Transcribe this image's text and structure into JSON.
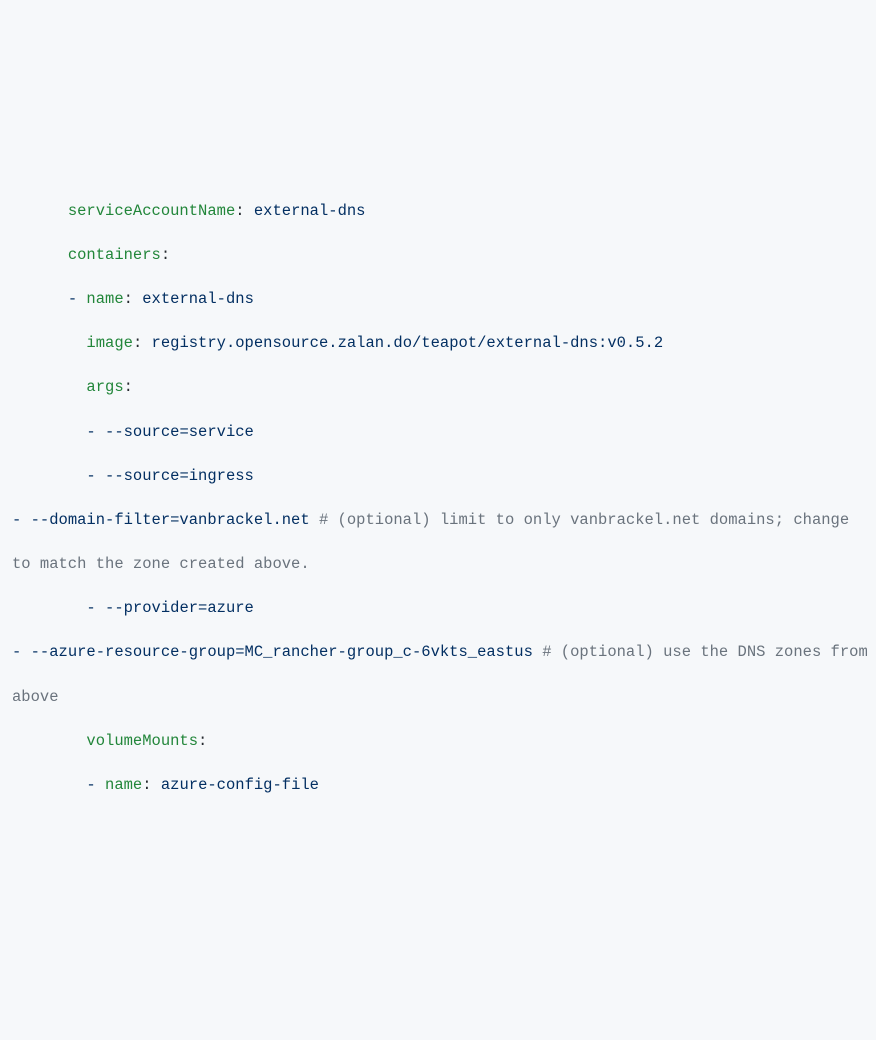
{
  "lines": {
    "l1": {
      "indent": "      ",
      "key": "serviceAccountName",
      "colon": ": ",
      "val": "external-dns"
    },
    "l2": {
      "indent": "      ",
      "key": "containers",
      "colon": ":"
    },
    "l3": {
      "indent": "      ",
      "dash": "- ",
      "key": "name",
      "colon": ": ",
      "val": "external-dns"
    },
    "l4": {
      "indent": "        ",
      "key": "image",
      "colon": ": ",
      "val": "registry.opensource.zalan.do/teapot/external-dns:v0.5.2"
    },
    "l5": {
      "indent": "        ",
      "key": "args",
      "colon": ":"
    },
    "l6": {
      "indent": "        ",
      "dash": "- ",
      "val": "--source=service"
    },
    "l7": {
      "indent": "        ",
      "dash": "- ",
      "val": "--source=ingress"
    },
    "l8": {
      "indent": "        ",
      "dash": "- ",
      "val": "--domain-filter=vanbrackel.net",
      "comment": " # (optional) limit to only vanbrackel.net domains; change to match the zone created above."
    },
    "l9": {
      "indent": "        ",
      "dash": "- ",
      "val": "--provider=azure"
    },
    "l10": {
      "indent": "        ",
      "dash": "- ",
      "val": "--azure-resource-group=MC_rancher-group_c-6vkts_eastus",
      "comment": " # (optional) use the DNS zones from above"
    },
    "l11": {
      "indent": "        ",
      "key": "volumeMounts",
      "colon": ":"
    },
    "l12": {
      "indent": "        ",
      "dash": "- ",
      "key": "name",
      "colon": ": ",
      "val": "azure-config-file"
    }
  }
}
